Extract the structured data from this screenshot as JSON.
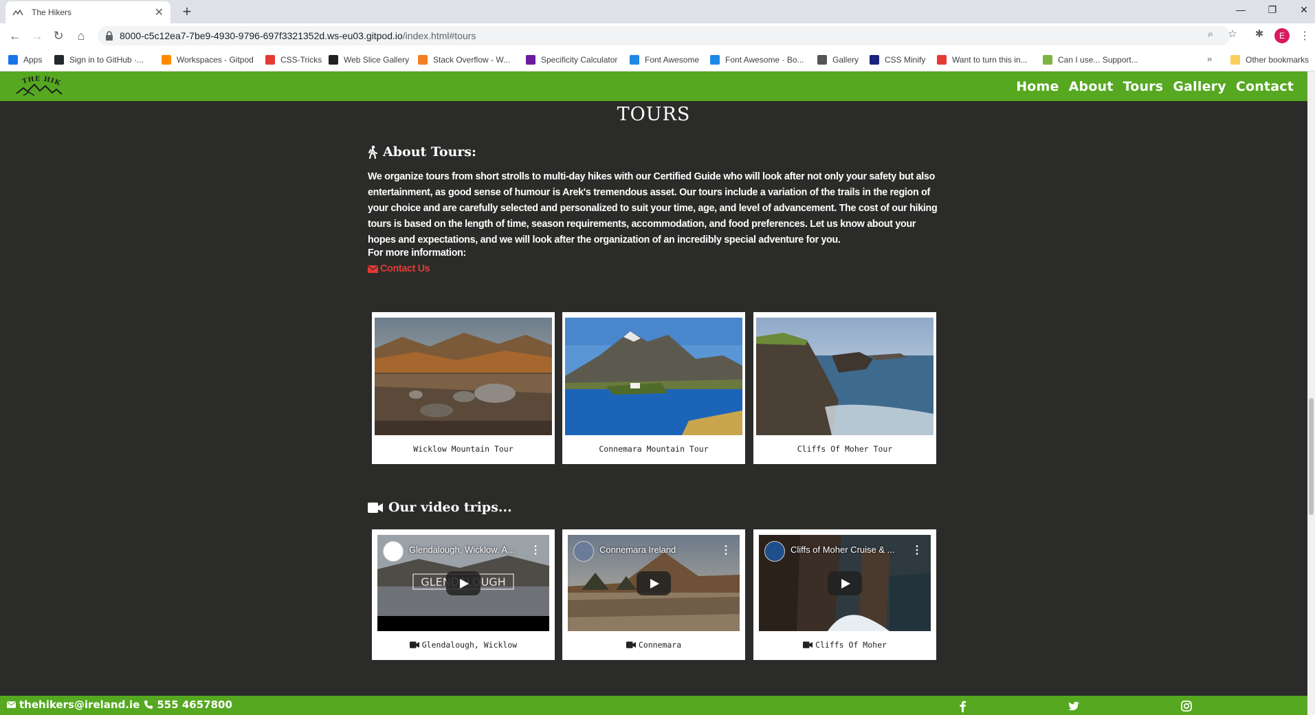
{
  "browser": {
    "tab_title": "The Hikers",
    "tab_close": "✕",
    "new_tab": "+",
    "url_host": "8000-c5c12ea7-7be9-4930-9796-697f3321352d.ws-eu03.gitpod.io",
    "url_path": "/index.html#tours",
    "avatar_letter": "E",
    "bookmarks": [
      {
        "label": "Apps",
        "icon": "apps-grid-icon",
        "color": "#1a73e8"
      },
      {
        "label": "Sign in to GitHub ·...",
        "icon": "github-icon",
        "color": "#24292e"
      },
      {
        "label": "Workspaces - Gitpod",
        "icon": "gitpod-icon",
        "color": "#ff8a00"
      },
      {
        "label": "CSS-Tricks",
        "icon": "css-tricks-icon",
        "color": "#e53935"
      },
      {
        "label": "Web Slice Gallery",
        "icon": "web-slice-icon",
        "color": "#222222"
      },
      {
        "label": "Stack Overflow - W...",
        "icon": "stackoverflow-icon",
        "color": "#f48024"
      },
      {
        "label": "Specificity Calculator",
        "icon": "specificity-icon",
        "color": "#6a1b9a"
      },
      {
        "label": "Font Awesome",
        "icon": "font-awesome-icon",
        "color": "#1e88e5"
      },
      {
        "label": "Font Awesome · Bo...",
        "icon": "bootstrap-icon",
        "color": "#1e88e5"
      },
      {
        "label": "Gallery",
        "icon": "gallery-icon",
        "color": "#555555"
      },
      {
        "label": "CSS Minify",
        "icon": "css-minify-icon",
        "color": "#1a237e"
      },
      {
        "label": "Want to turn this in...",
        "icon": "opera-icon",
        "color": "#e53935"
      },
      {
        "label": "Can I use... Support...",
        "icon": "caniuse-icon",
        "color": "#7cb342"
      }
    ],
    "other_bookmarks": "Other bookmarks",
    "bookmarks_more": "»"
  },
  "nav": {
    "logo_alt": "THE HIKERS",
    "items": [
      "Home",
      "About",
      "Tours",
      "Gallery",
      "Contact"
    ]
  },
  "page": {
    "title": "TOURS",
    "about_heading": "About Tours:",
    "about_text": "We organize tours from short strolls to multi-day hikes with our Certified Guide who will look after not only your safety but also entertainment, as good sense of humour is Arek's tremendous asset. Our tours include a variation of the trails in the region of your choice and are carefully selected and personalized to suit your time, age, and level of advancement. The cost of our hiking tours is based on the length of time, season requirements, accommodation, and food preferences. Let us know about your hopes and expectations, and we will look after the organization of an incredibly special adventure for you.",
    "more_info": "For more information:",
    "contact_link": "Contact Us"
  },
  "tours": [
    {
      "caption": "Wicklow Mountain Tour"
    },
    {
      "caption": "Connemara Mountain Tour"
    },
    {
      "caption": "Cliffs Of Moher Tour"
    }
  ],
  "videos_heading": "Our video trips...",
  "videos": [
    {
      "title": "Glendalough, Wicklow. A...",
      "caption": "Glendalough, Wicklow",
      "overlay": "GLENDALOUGH"
    },
    {
      "title": "Connemara Ireland",
      "caption": "Connemara"
    },
    {
      "title": "Cliffs of Moher Cruise & ...",
      "caption": "Cliffs Of Moher"
    }
  ],
  "footer": {
    "email": "thehikers@ireland.ie",
    "phone": "555 4657800",
    "social": [
      "facebook-icon",
      "twitter-icon",
      "instagram-icon"
    ]
  },
  "colors": {
    "brand_green": "#55a820",
    "page_bg": "#2b2c29",
    "link_red": "#e53935"
  }
}
